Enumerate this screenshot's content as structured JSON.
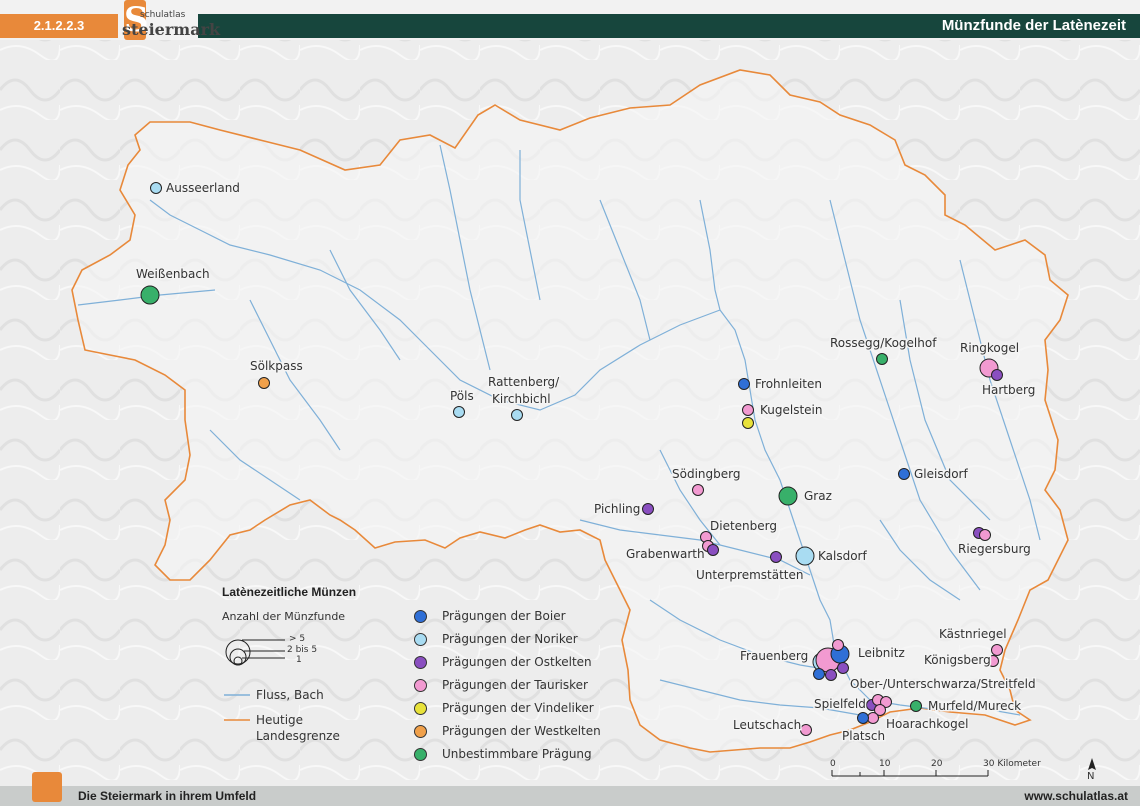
{
  "header": {
    "code": "2.1.2.2.3",
    "logo_top": "schulatlas",
    "logo_main": "steiermark",
    "logo_letter": "S",
    "title": "Münzfunde der Latènezeit"
  },
  "footer": {
    "left_text": "Die Steiermark in ihrem Umfeld",
    "url": "www.schulatlas.at"
  },
  "colors": {
    "boier": "#2f6fd6",
    "noriker": "#a9dcf2",
    "ostkelten": "#8a4fc0",
    "taurisker": "#f29ad1",
    "vindeliker": "#e8e23a",
    "westkelten": "#f0a04a",
    "unbestimmbar": "#38b06a",
    "river": "#7fb0d8",
    "border": "#e8893a"
  },
  "legend": {
    "title": "Latènezeitliche Münzen",
    "size_title": "Anzahl der Münzfunde",
    "size_labels": [
      "> 5",
      "2 bis 5",
      "1"
    ],
    "river_label": "Fluss, Bach",
    "border_label_1": "Heutige",
    "border_label_2": "Landesgrenze",
    "categories": [
      {
        "key": "boier",
        "label": "Prägungen der Boier"
      },
      {
        "key": "noriker",
        "label": "Prägungen der Noriker"
      },
      {
        "key": "ostkelten",
        "label": "Prägungen der Ostkelten"
      },
      {
        "key": "taurisker",
        "label": "Prägungen der Taurisker"
      },
      {
        "key": "vindeliker",
        "label": "Prägungen der Vindeliker"
      },
      {
        "key": "westkelten",
        "label": "Prägungen der Westkelten"
      },
      {
        "key": "unbestimmbar",
        "label": "Unbestimmbare Prägung"
      }
    ]
  },
  "scale": {
    "ticks": [
      "0",
      "10",
      "20",
      "30 Kilometer"
    ],
    "north": "N"
  },
  "places": [
    {
      "name": "Ausseerland",
      "type": "noriker",
      "count": "1"
    },
    {
      "name": "Weißenbach",
      "type": "unbestimmbar",
      "count": "2 bis 5"
    },
    {
      "name": "Sölkpass",
      "type": "westkelten",
      "count": "1"
    },
    {
      "name": "Pöls",
      "type": "noriker",
      "count": "1"
    },
    {
      "name": "Rattenberg/",
      "name2": "Kirchbichl",
      "type": "noriker",
      "count": "1"
    },
    {
      "name": "Rossegg/Kogelhof",
      "type": "unbestimmbar",
      "count": "1"
    },
    {
      "name": "Ringkogel",
      "type": "taurisker",
      "count": "2 bis 5"
    },
    {
      "name": "Hartberg",
      "type": "ostkelten",
      "count": "1"
    },
    {
      "name": "Frohnleiten",
      "type": "boier",
      "count": "1"
    },
    {
      "name": "Kugelstein",
      "type": "taurisker",
      "count": "1"
    },
    {
      "name": "Gleisdorf",
      "type": "boier",
      "count": "1"
    },
    {
      "name": "Södingberg",
      "type": "taurisker",
      "count": "1"
    },
    {
      "name": "Graz",
      "type": "unbestimmbar",
      "count": "2 bis 5"
    },
    {
      "name": "Pichling",
      "type": "ostkelten",
      "count": "1"
    },
    {
      "name": "Dietenberg",
      "type": "taurisker",
      "count": "1"
    },
    {
      "name": "Grabenwarth",
      "type": "ostkelten",
      "count": "1"
    },
    {
      "name": "Kalsdorf",
      "type": "noriker",
      "count": "2 bis 5"
    },
    {
      "name": "Unterpremstätten",
      "type": "ostkelten",
      "count": "1"
    },
    {
      "name": "Riegersburg",
      "type": "ostkelten",
      "count": "1"
    },
    {
      "name": "Kästnriegel",
      "type": "taurisker",
      "count": "1"
    },
    {
      "name": "Königsberg",
      "type": "taurisker",
      "count": "1"
    },
    {
      "name": "Frauenberg",
      "type": "noriker",
      "count": "2 bis 5"
    },
    {
      "name": "Leibnitz",
      "type": "boier",
      "count": "> 5"
    },
    {
      "name": "Ober-/Unterschwarza/Streitfeld",
      "type": "ostkelten",
      "count": "1"
    },
    {
      "name": "Spielfeld",
      "type": "taurisker",
      "count": "1"
    },
    {
      "name": "Murfeld/Mureck",
      "type": "unbestimmbar",
      "count": "1"
    },
    {
      "name": "Hoarachkogel",
      "type": "taurisker",
      "count": "1"
    },
    {
      "name": "Leutschach",
      "type": "taurisker",
      "count": "1"
    },
    {
      "name": "Platsch",
      "type": "boier",
      "count": "1"
    }
  ]
}
